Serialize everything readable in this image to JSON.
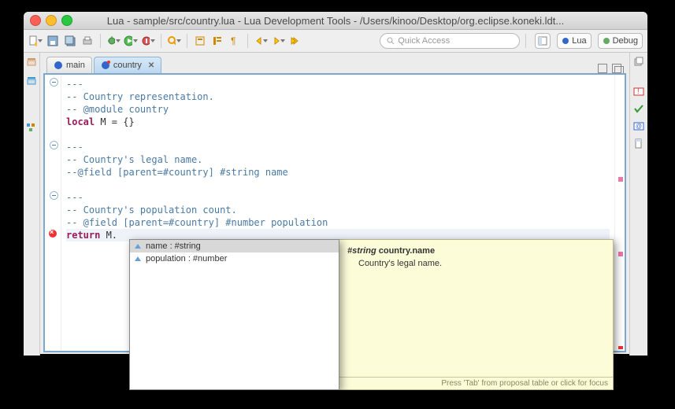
{
  "window": {
    "title": "Lua - sample/src/country.lua - Lua Development Tools - /Users/kinoo/Desktop/org.eclipse.koneki.ldt..."
  },
  "toolbar": {
    "quick_access_placeholder": "Quick Access",
    "persp_lua": "Lua",
    "persp_debug": "Debug"
  },
  "tabs": [
    {
      "label": "main",
      "active": false
    },
    {
      "label": "country",
      "active": true
    }
  ],
  "code": {
    "l1": "---",
    "l2": "-- Country representation.",
    "l3": "-- @module country",
    "l4_kw": "local",
    "l4_rest": " M = {}",
    "l5": "",
    "l6": "---",
    "l7": "-- Country's legal name.",
    "l8": "--@field [parent=#country] #string name",
    "l9": "",
    "l10": "---",
    "l11": "-- Country's population count.",
    "l12": "-- @field [parent=#country] #number population",
    "l13_kw": "return",
    "l13_rest": " M."
  },
  "autocomplete": {
    "items": [
      {
        "label": "name : #string",
        "selected": true
      },
      {
        "label": "population : #number",
        "selected": false
      }
    ]
  },
  "doc": {
    "type": "#string",
    "name": "country.name",
    "desc": "Country's legal name.",
    "footer": "Press 'Tab' from proposal table or click for focus"
  }
}
